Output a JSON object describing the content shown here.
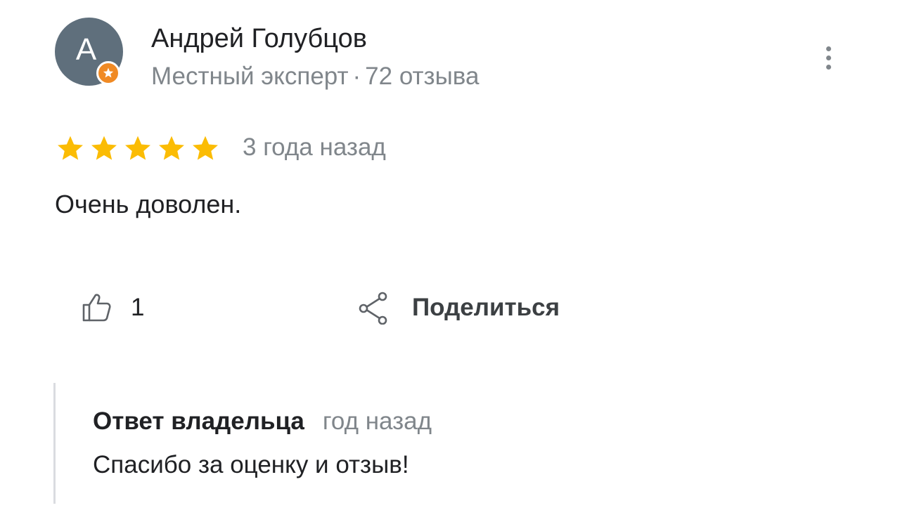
{
  "author": {
    "avatar_letter": "A",
    "name": "Андрей Голубцов",
    "role": "Местный эксперт",
    "meta_separator": "·",
    "reviews_count": "72 отзыва",
    "avatar_color": "#5f6f7c",
    "badge_color": "#f08a24"
  },
  "menu": {
    "icon": "more-vert-icon"
  },
  "rating": {
    "stars": 5,
    "max_stars": 5,
    "star_color": "#fbbc04",
    "date": "3 года назад"
  },
  "review": {
    "text": "Очень доволен."
  },
  "actions": {
    "like_icon": "thumb-up-icon",
    "like_count": "1",
    "share_icon": "share-icon",
    "share_label": "Поделиться"
  },
  "owner_reply": {
    "label": "Ответ владельца",
    "date": "год назад",
    "text": "Спасибо за оценку и отзыв!"
  }
}
